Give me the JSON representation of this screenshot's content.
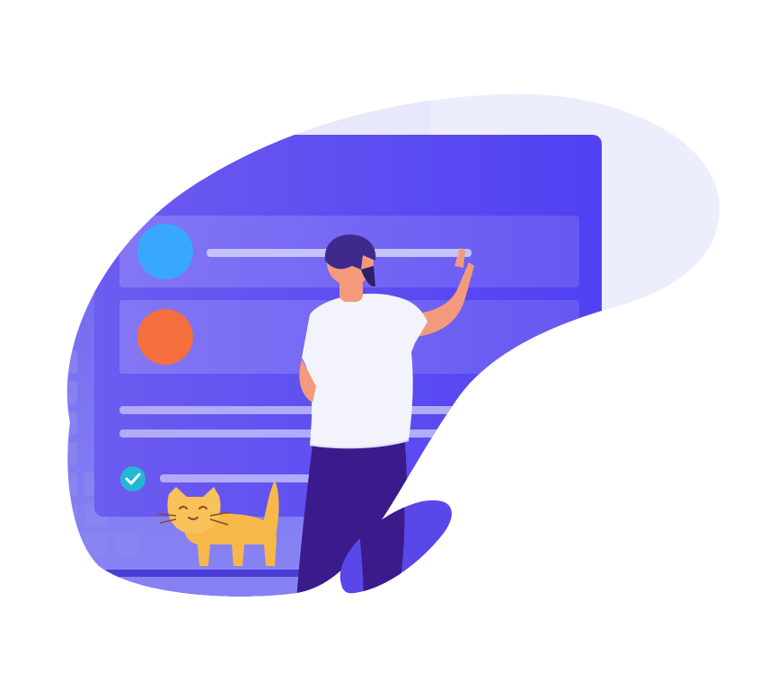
{
  "illustration": {
    "subject": "person-pointing-at-checklist-board",
    "icons": [
      "blue-circle-icon",
      "orange-circle-icon",
      "check-icon",
      "cat-icon"
    ]
  },
  "colors": {
    "background": "#ffffff",
    "blob_light": "#e7e8fb",
    "board": "#5a47ea",
    "board_light": "#7a6cf1",
    "blue_dot": "#3aa7ff",
    "orange_dot": "#f46f3c",
    "check": "#22b7d3",
    "shirt": "#f2f3fb",
    "pants": "#3b1a8c",
    "hair": "#3f2a8c",
    "skin": "#f49a7c",
    "cat": "#f7b84a"
  }
}
